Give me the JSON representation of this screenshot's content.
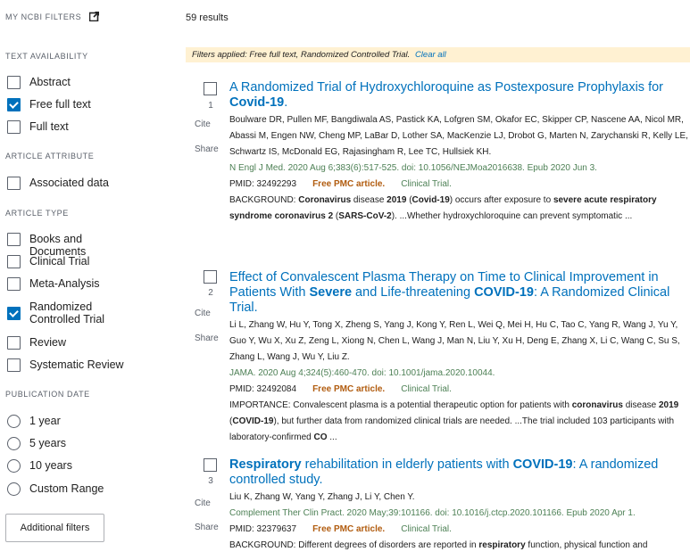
{
  "sidebar": {
    "my_filters": "MY NCBI FILTERS",
    "sections": [
      {
        "heading": "TEXT AVAILABILITY",
        "items": [
          {
            "label": "Abstract",
            "checked": false
          },
          {
            "label": "Free full text",
            "checked": true
          },
          {
            "label": "Full text",
            "checked": false
          }
        ]
      },
      {
        "heading": "ARTICLE ATTRIBUTE",
        "items": [
          {
            "label": "Associated data",
            "checked": false
          }
        ]
      },
      {
        "heading": "ARTICLE TYPE",
        "items": [
          {
            "label": "Books and Documents",
            "checked": false
          },
          {
            "label": "Clinical Trial",
            "checked": false
          },
          {
            "label": "Meta-Analysis",
            "checked": false
          },
          {
            "label": "Randomized Controlled Trial",
            "checked": true
          },
          {
            "label": "Review",
            "checked": false
          },
          {
            "label": "Systematic Review",
            "checked": false
          }
        ]
      },
      {
        "heading": "PUBLICATION DATE",
        "items": [
          {
            "label": "1 year"
          },
          {
            "label": "5 years"
          },
          {
            "label": "10 years"
          },
          {
            "label": "Custom Range"
          }
        ]
      }
    ],
    "additional_filters": "Additional filters"
  },
  "main": {
    "results_count": "59 results",
    "filters_applied": "Filters applied: Free full text, Randomized Controlled Trial.",
    "clear_all": "Clear all",
    "cite_label": "Cite",
    "share_label": "Share",
    "results": [
      {
        "number": "1",
        "title_parts": [
          {
            "t": "A Randomized Trial of Hydroxychloroquine as Postexposure Prophylaxis for ",
            "b": false
          },
          {
            "t": "Covid-19",
            "b": true
          },
          {
            "t": ".",
            "b": false
          }
        ],
        "authors": "Boulware DR, Pullen MF, Bangdiwala AS, Pastick KA, Lofgren SM, Okafor EC, Skipper CP, Nascene AA, Nicol MR, Abassi M, Engen NW, Cheng MP, LaBar D, Lother SA, MacKenzie LJ, Drobot G, Marten N, Zarychanski R, Kelly LE, Schwartz IS, McDonald EG, Rajasingham R, Lee TC, Hullsiek KH.",
        "citation": "N Engl J Med. 2020 Aug 6;383(6):517-525. doi: 10.1056/NEJMoa2016638. Epub 2020 Jun 3.",
        "pmid": "PMID: 32492293",
        "pmc": "Free PMC article.",
        "article_type": "Clinical Trial.",
        "snippet_parts": [
          {
            "t": "BACKGROUND: ",
            "b": false
          },
          {
            "t": "Coronavirus",
            "b": true
          },
          {
            "t": " disease ",
            "b": false
          },
          {
            "t": "2019",
            "b": true
          },
          {
            "t": " (",
            "b": false
          },
          {
            "t": "Covid-19",
            "b": true
          },
          {
            "t": ") occurs after exposure to ",
            "b": false
          },
          {
            "t": "severe acute respiratory syndrome coronavirus 2",
            "b": true
          },
          {
            "t": " (",
            "b": false
          },
          {
            "t": "SARS-CoV-2",
            "b": true
          },
          {
            "t": "). ...Whether hydroxychloroquine can prevent symptomatic ...",
            "b": false
          }
        ]
      },
      {
        "number": "2",
        "title_parts": [
          {
            "t": "Effect of Convalescent Plasma Therapy on Time to Clinical Improvement in Patients With ",
            "b": false
          },
          {
            "t": "Severe",
            "b": true
          },
          {
            "t": " and Life-threatening ",
            "b": false
          },
          {
            "t": "COVID-19",
            "b": true
          },
          {
            "t": ": A Randomized Clinical Trial.",
            "b": false
          }
        ],
        "authors": "Li L, Zhang W, Hu Y, Tong X, Zheng S, Yang J, Kong Y, Ren L, Wei Q, Mei H, Hu C, Tao C, Yang R, Wang J, Yu Y, Guo Y, Wu X, Xu Z, Zeng L, Xiong N, Chen L, Wang J, Man N, Liu Y, Xu H, Deng E, Zhang X, Li C, Wang C, Su S, Zhang L, Wang J, Wu Y, Liu Z.",
        "citation": "JAMA. 2020 Aug 4;324(5):460-470. doi: 10.1001/jama.2020.10044.",
        "pmid": "PMID: 32492084",
        "pmc": "Free PMC article.",
        "article_type": "Clinical Trial.",
        "snippet_parts": [
          {
            "t": "IMPORTANCE: Convalescent plasma is a potential therapeutic option for patients with ",
            "b": false
          },
          {
            "t": "coronavirus",
            "b": true
          },
          {
            "t": " disease ",
            "b": false
          },
          {
            "t": "2019",
            "b": true
          },
          {
            "t": " (",
            "b": false
          },
          {
            "t": "COVID-19",
            "b": true
          },
          {
            "t": "), but further data from randomized clinical trials are needed. ...The trial included 103 participants with laboratory-confirmed ",
            "b": false
          },
          {
            "t": "CO",
            "b": true
          },
          {
            "t": " ...",
            "b": false
          }
        ]
      },
      {
        "number": "3",
        "title_parts": [
          {
            "t": "Respiratory",
            "b": true
          },
          {
            "t": " rehabilitation in elderly patients with ",
            "b": false
          },
          {
            "t": "COVID-19",
            "b": true
          },
          {
            "t": ": A randomized controlled study.",
            "b": false
          }
        ],
        "authors": "Liu K, Zhang W, Yang Y, Zhang J, Li Y, Chen Y.",
        "citation": "Complement Ther Clin Pract. 2020 May;39:101166. doi: 10.1016/j.ctcp.2020.101166. Epub 2020 Apr 1.",
        "pmid": "PMID: 32379637",
        "pmc": "Free PMC article.",
        "article_type": "Clinical Trial.",
        "snippet_parts": [
          {
            "t": "BACKGROUND: Different degrees of disorders are reported in ",
            "b": false
          },
          {
            "t": "respiratory",
            "b": true
          },
          {
            "t": " function, physical function and",
            "b": false
          }
        ]
      }
    ]
  },
  "colors": {
    "link": "#0071bc",
    "citation": "#4d8055",
    "pmc": "#b15c0f",
    "filter_bar_bg": "#fff1d2"
  },
  "icons": {
    "external_link": "external-link-icon"
  }
}
